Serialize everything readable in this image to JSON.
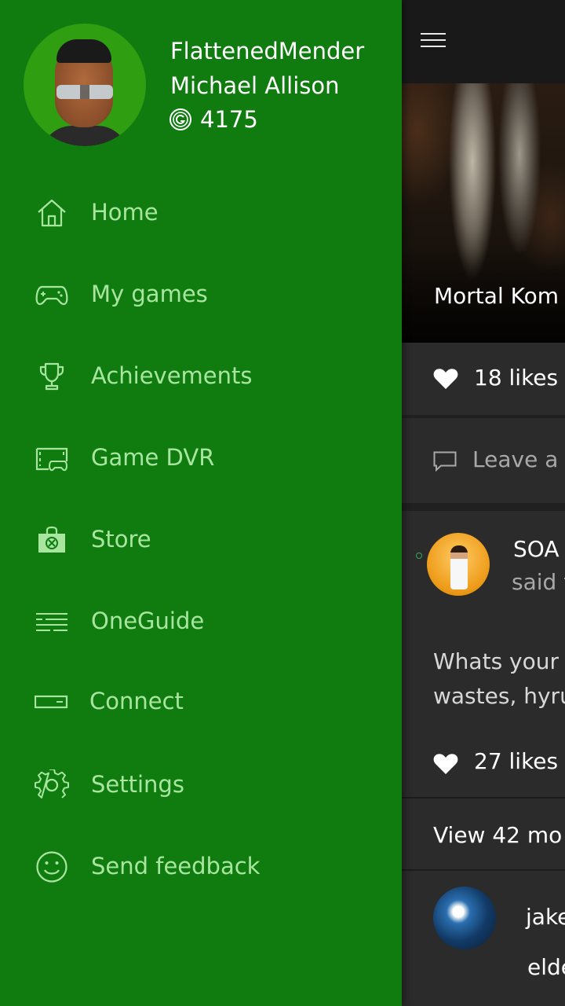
{
  "profile": {
    "gamertag": "FlattenedMender",
    "real_name": "Michael Allison",
    "gamerscore": "4175"
  },
  "nav": {
    "items": [
      {
        "label": "Home",
        "icon": "home-icon"
      },
      {
        "label": "My games",
        "icon": "controller-icon"
      },
      {
        "label": "Achievements",
        "icon": "trophy-icon"
      },
      {
        "label": "Game DVR",
        "icon": "game-dvr-icon"
      },
      {
        "label": "Store",
        "icon": "store-icon"
      },
      {
        "label": "OneGuide",
        "icon": "oneguide-icon"
      },
      {
        "label": "Connect",
        "icon": "connect-icon"
      },
      {
        "label": "Settings",
        "icon": "gear-icon"
      },
      {
        "label": "Send feedback",
        "icon": "smiley-icon"
      }
    ]
  },
  "feed": {
    "hero_title": "Mortal Kom",
    "likes": "18 likes",
    "comment_placeholder": "Leave a c",
    "post": {
      "author": "SOA",
      "said": "said t",
      "body_line1": "Whats your f",
      "body_line2": "wastes, hyrul",
      "likes": "27 likes",
      "view_more": "View 42 mo"
    },
    "reply": {
      "author": "jake",
      "body": "elde"
    }
  },
  "colors": {
    "drawer_green": "#107c10",
    "nav_label": "#a8e6a0",
    "feed_bg": "#2b2b2b"
  }
}
